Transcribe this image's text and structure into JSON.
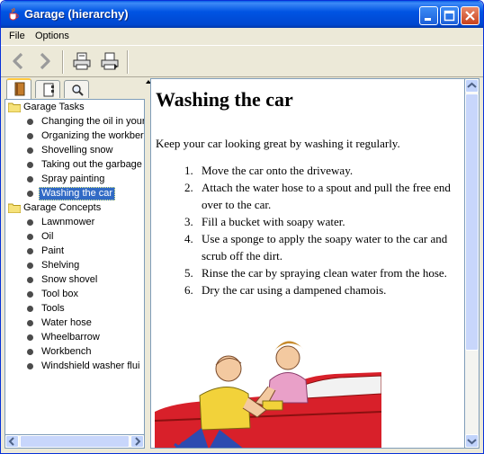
{
  "window": {
    "title": "Garage (hierarchy)",
    "title_icon": "java-cup-icon",
    "controls": [
      "minimize-icon",
      "maximize-icon",
      "close-icon"
    ]
  },
  "menubar": {
    "file": "File",
    "options": "Options"
  },
  "toolbar": {
    "buttons": [
      "back-arrow-icon",
      "forward-arrow-icon",
      "print-icon",
      "page-setup-icon"
    ]
  },
  "navigator": {
    "tabs": [
      "toc-book-icon",
      "index-icon",
      "search-magnifier-icon"
    ],
    "active_tab": 0,
    "tree": [
      {
        "label": "Garage Tasks",
        "type": "folder",
        "children": [
          "Changing the oil in your",
          "Organizing the workber",
          "Shovelling snow",
          "Taking out the garbage",
          "Spray painting",
          "Washing the car"
        ]
      },
      {
        "label": "Garage Concepts",
        "type": "folder",
        "children": [
          "Lawnmower",
          "Oil",
          "Paint",
          "Shelving",
          "Snow shovel",
          "Tool box",
          "Tools",
          "Water hose",
          "Wheelbarrow",
          "Workbench",
          "Windshield washer flui"
        ]
      }
    ],
    "selected": "Washing the car"
  },
  "content": {
    "heading": "Washing the car",
    "intro": "Keep your car looking great by washing it regularly.",
    "steps": [
      {
        "num": "1.",
        "text": "Move the car onto the driveway."
      },
      {
        "num": "2.",
        "text": "Attach the water hose to a spout and pull the free end over to the car."
      },
      {
        "num": "3.",
        "text": "Fill a bucket with soapy water."
      },
      {
        "num": "4.",
        "text": "Use a sponge to apply the soapy water to the car and scrub off the dirt."
      },
      {
        "num": "5.",
        "text": "Rinse the car by spraying clean water from the hose."
      },
      {
        "num": "6.",
        "text": "Dry the car using a dampened chamois."
      }
    ],
    "illustration": "two-people-washing-red-car-image"
  },
  "colors": {
    "title_bar": "#0054e3",
    "selection": "#316ac5",
    "car_red": "#d8202a"
  }
}
